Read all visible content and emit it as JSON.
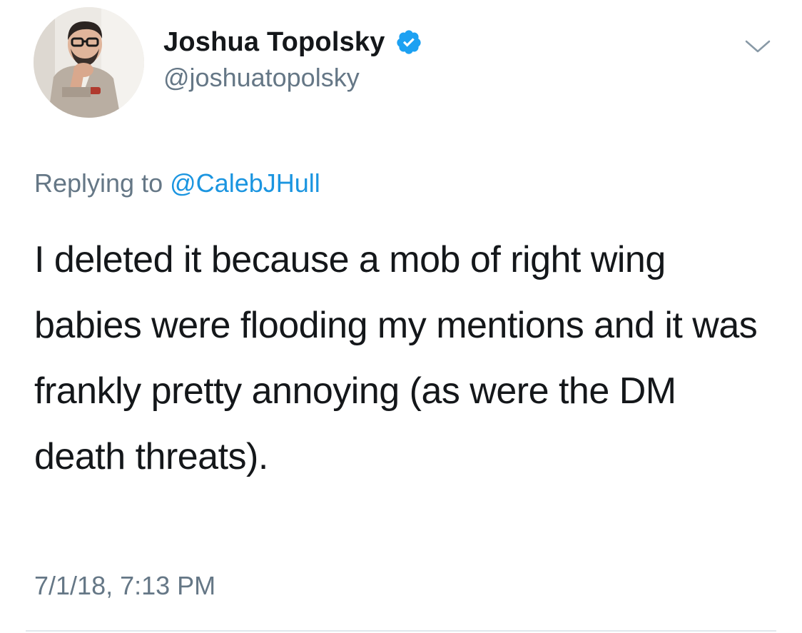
{
  "author": {
    "display_name": "Joshua Topolsky",
    "handle": "@joshuatopolsky",
    "verified": true,
    "verified_color": "#1da1f2"
  },
  "icons": {
    "verified": "verified-badge-icon",
    "menu": "chevron-down-icon",
    "avatar": "profile-photo"
  },
  "reply": {
    "prefix": "Replying to",
    "to_handle": "@CalebJHull"
  },
  "tweet": {
    "text": "I deleted it because a mob of right wing babies were flooding my mentions and it was frankly pretty annoying (as were the DM death threats).",
    "timestamp": "7/1/18, 7:13 PM"
  },
  "colors": {
    "text": "#14171a",
    "secondary": "#657786",
    "link": "#1b95e0",
    "divider": "#e1e8ed"
  }
}
